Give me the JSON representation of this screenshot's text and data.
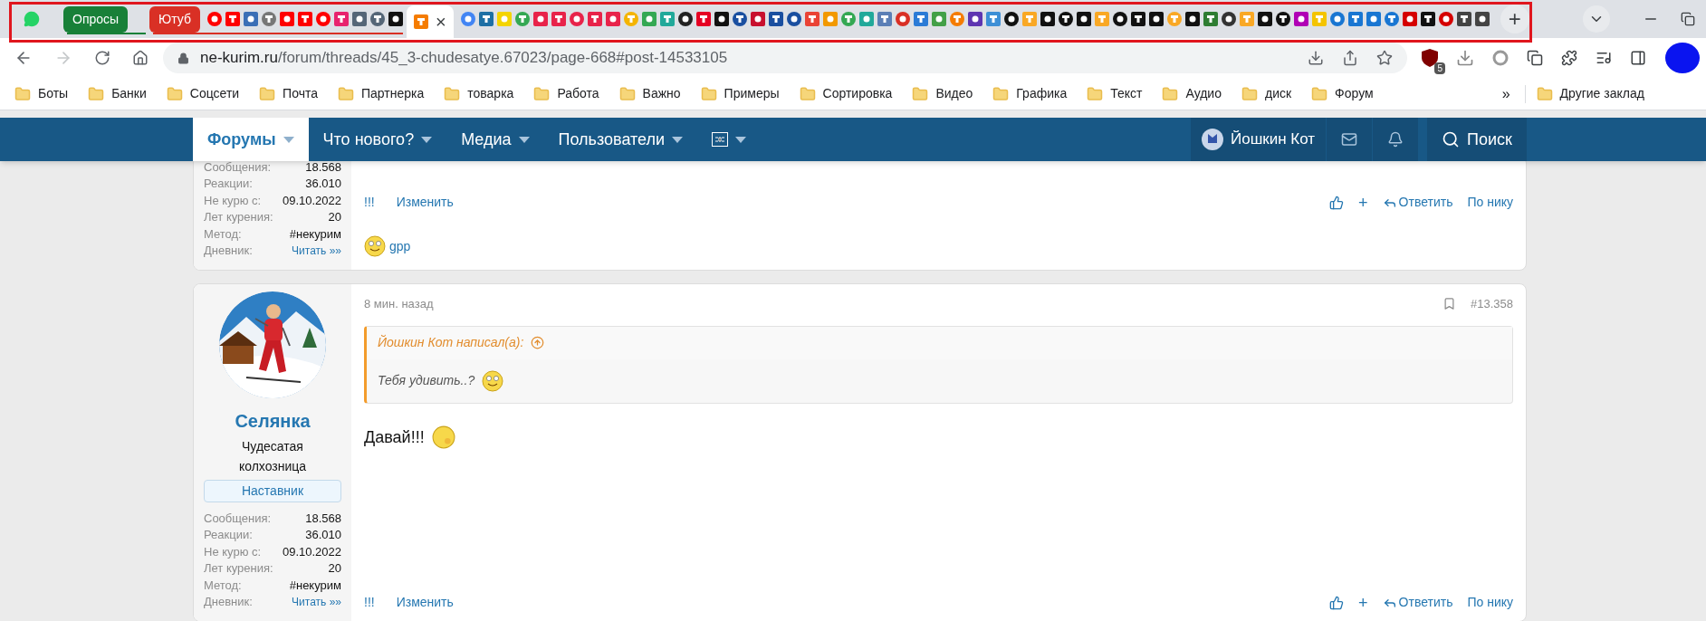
{
  "browser": {
    "tab_groups": [
      {
        "label": "Опросы",
        "color": "#188038"
      },
      {
        "label": "Ютуб",
        "color": "#d93025"
      }
    ],
    "active_tab_close": "×",
    "new_tab": "+",
    "url": {
      "host": "ne-kurim.ru",
      "path": "/forum/threads/45_3-chudesatye.67023/page-668#post-14533105"
    },
    "extension_badge": "5",
    "bookmarks": [
      "Боты",
      "Банки",
      "Соцсети",
      "Почта",
      "Партнерка",
      "товарка",
      "Работа",
      "Важно",
      "Примеры",
      "Сортировка",
      "Видео",
      "Графика",
      "Текст",
      "Аудио",
      "диск",
      "Форум"
    ],
    "bookmarks_more": "»",
    "other_bookmarks": "Другие заклад"
  },
  "nav": {
    "items": [
      {
        "label": "Форумы",
        "selected": true
      },
      {
        "label": "Что нового?",
        "selected": false
      },
      {
        "label": "Медиа",
        "selected": false
      },
      {
        "label": "Пользователи",
        "selected": false
      }
    ],
    "user": "Йошкин Кот",
    "search": "Поиск"
  },
  "posts": [
    {
      "kind": "partial",
      "user": {
        "stats": [
          {
            "label": "Сообщения:",
            "value": "18.568"
          },
          {
            "label": "Реакции:",
            "value": "36.010"
          },
          {
            "label": "Не курю с:",
            "value": "09.10.2022"
          },
          {
            "label": "Лет курения:",
            "value": "20"
          },
          {
            "label": "Метод:",
            "value": "#некурим"
          },
          {
            "label": "Дневник:",
            "value": "Читать »»",
            "link": true
          }
        ]
      },
      "footer": {
        "marks": "!!!",
        "edit": "Изменить",
        "plus": "+",
        "reply": "Ответить",
        "by_nick": "По нику"
      },
      "reaction_link": "gpp"
    },
    {
      "kind": "full",
      "time": "8 мин. назад",
      "number": "#13.358",
      "user": {
        "name": "Селянка",
        "title": "Чудесатая колхозница",
        "badge": "Наставник",
        "stats": [
          {
            "label": "Сообщения:",
            "value": "18.568"
          },
          {
            "label": "Реакции:",
            "value": "36.010"
          },
          {
            "label": "Не курю с:",
            "value": "09.10.2022"
          },
          {
            "label": "Лет курения:",
            "value": "20"
          },
          {
            "label": "Метод:",
            "value": "#некурим"
          },
          {
            "label": "Дневник:",
            "value": "Читать »»",
            "link": true
          }
        ]
      },
      "quote": {
        "author": "Йошкин Кот написал(а):",
        "text": "Тебя удивить..?"
      },
      "message": "Давай!!!",
      "footer": {
        "marks": "!!!",
        "edit": "Изменить",
        "plus": "+",
        "reply": "Ответить",
        "by_nick": "По нику"
      }
    }
  ]
}
